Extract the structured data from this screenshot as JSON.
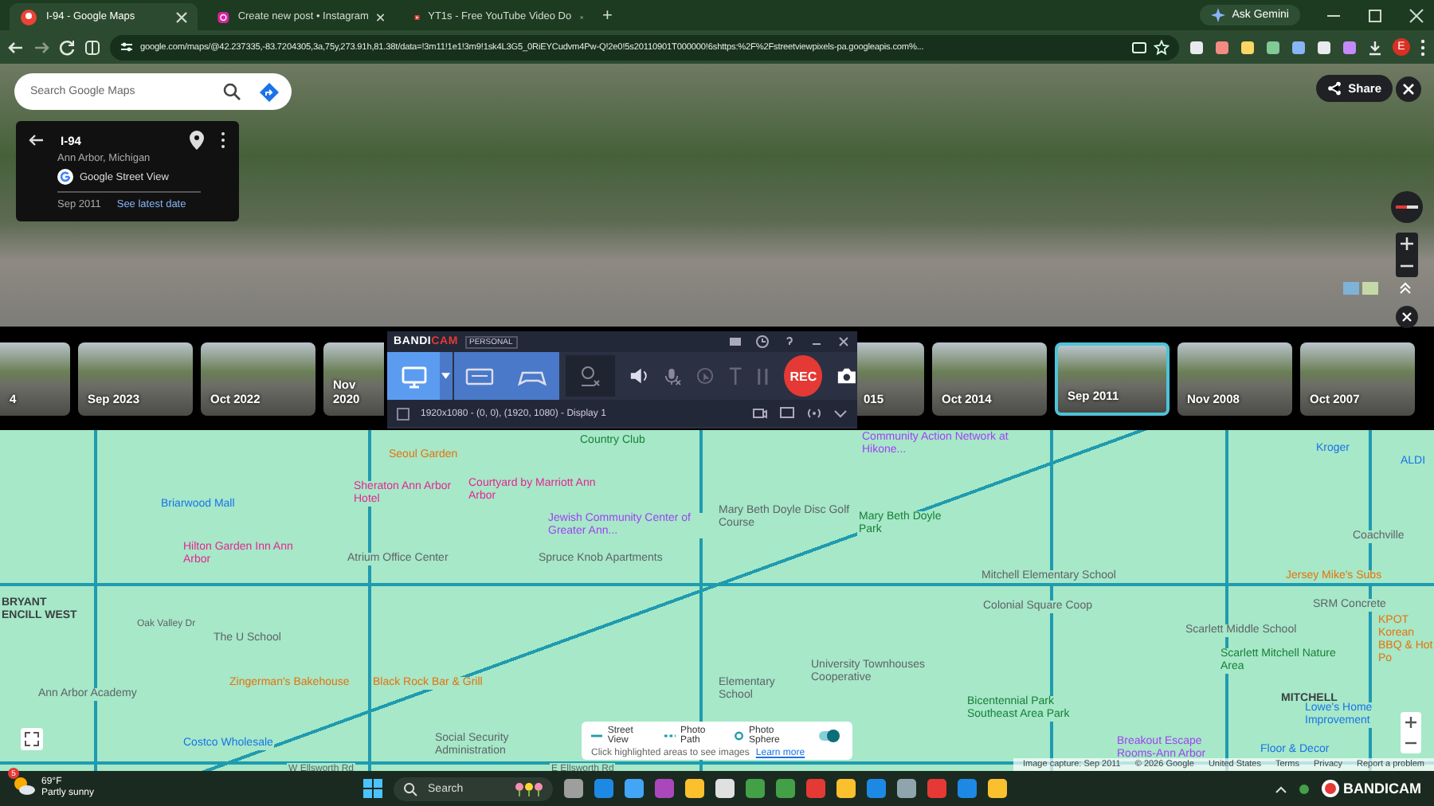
{
  "browser": {
    "tabs": [
      {
        "title": "I-94 - Google Maps",
        "kind": "maps",
        "selected": true
      },
      {
        "title": "Create new post • Instagram",
        "kind": "instagram",
        "selected": false
      },
      {
        "title": "YT1s - Free YouTube Video Do",
        "kind": "video",
        "selected": false
      }
    ],
    "new_tab": "+",
    "gemini": "Ask Gemini",
    "profile": "E",
    "url": "google.com/maps/@42.237335,-83.7204305,3a,75y,273.91h,81.38t/data=!3m11!1e1!3m9!1sk4L3G5_0RiEYCudvm4Pw-Q!2e0!5s20110901T000000!6shttps:%2F%2Fstreetviewpixels-pa.googleapis.com%..."
  },
  "street_view": {
    "search": {
      "placeholder": "Search Google Maps"
    },
    "card": {
      "title": "I-94",
      "subtitle": "Ann Arbor, Michigan",
      "source": "Google Street View",
      "date": "Sep 2011",
      "link": "See latest date"
    },
    "share": "Share"
  },
  "timeline": {
    "before": [
      {
        "label": "4",
        "selected": false
      },
      {
        "label": "Sep 2023",
        "selected": false
      },
      {
        "label": "Oct 2022",
        "selected": false
      },
      {
        "label": "Nov 2020",
        "selected": false
      }
    ],
    "after": [
      {
        "label": "015",
        "selected": false
      },
      {
        "label": "Oct 2014",
        "selected": false
      },
      {
        "label": "Sep 2011",
        "selected": true
      },
      {
        "label": "Nov 2008",
        "selected": false
      },
      {
        "label": "Oct 2007",
        "selected": false
      }
    ]
  },
  "recorder": {
    "logo": [
      "BANDI",
      "CAM"
    ],
    "edition": "PERSONAL",
    "modes": [
      {
        "kind": "screen",
        "selected": true
      },
      {
        "kind": "hdmi",
        "selected": false
      },
      {
        "kind": "game",
        "selected": false
      }
    ],
    "rec": "REC",
    "area": "1920x1080 - (0, 0), (1920, 1080) - Display 1",
    "area_checked": false
  },
  "map": {
    "labels": [
      {
        "text": "Country Club",
        "kind": "park"
      },
      {
        "text": "Community Action Network at Hikone...",
        "kind": "community"
      },
      {
        "text": "Kroger",
        "kind": "shop"
      },
      {
        "text": "Seoul Garden",
        "kind": "food"
      },
      {
        "text": "ALDI",
        "kind": "shop"
      },
      {
        "text": "Sheraton Ann Arbor Hotel",
        "kind": "hotel"
      },
      {
        "text": "Courtyard by Marriott Ann Arbor",
        "kind": "hotel"
      },
      {
        "text": "Briarwood Mall",
        "kind": "shop"
      },
      {
        "text": "Jewish Community Center of Greater Ann...",
        "kind": "community"
      },
      {
        "text": "Mary Beth Doyle Disc Golf Course",
        "kind": "place"
      },
      {
        "text": "Mary Beth Doyle Park",
        "kind": "park"
      },
      {
        "text": "Coachville",
        "kind": "place"
      },
      {
        "text": "Hilton Garden Inn Ann Arbor",
        "kind": "hotel"
      },
      {
        "text": "Atrium Office Center",
        "kind": "place"
      },
      {
        "text": "Spruce Knob Apartments",
        "kind": "place"
      },
      {
        "text": "Mitchell Elementary School",
        "kind": "place"
      },
      {
        "text": "Jersey Mike's Subs",
        "kind": "food"
      },
      {
        "text": "BRYANT",
        "kind": "area"
      },
      {
        "text": "Colonial Square Coop",
        "kind": "place"
      },
      {
        "text": "SRM Concrete",
        "kind": "place"
      },
      {
        "text": "ENCILL WEST",
        "kind": "area"
      },
      {
        "text": "Oak Valley Dr",
        "kind": "road"
      },
      {
        "text": "The U School",
        "kind": "place"
      },
      {
        "text": "Scarlett Middle School",
        "kind": "place"
      },
      {
        "text": "Scarlett Mitchell Nature Area",
        "kind": "park"
      },
      {
        "text": "University Townhouses Cooperative",
        "kind": "place"
      },
      {
        "text": "KPOT Korean BBQ & Hot Po",
        "kind": "food"
      },
      {
        "text": "Ann Arbor Academy",
        "kind": "place"
      },
      {
        "text": "Zingerman's Bakehouse",
        "kind": "food"
      },
      {
        "text": "Black Rock Bar & Grill",
        "kind": "food"
      },
      {
        "text": "Elementary School",
        "kind": "place"
      },
      {
        "text": "Bicentennial Park Southeast Area Park",
        "kind": "park"
      },
      {
        "text": "MITCHELL",
        "kind": "area"
      },
      {
        "text": "Lowe's Home Improvement",
        "kind": "shop"
      },
      {
        "text": "Costco Wholesale",
        "kind": "shop"
      },
      {
        "text": "Social Security Administration",
        "kind": "place"
      },
      {
        "text": "Breakout Escape Rooms-Ann Arbor",
        "kind": "community"
      },
      {
        "text": "Floor & Decor",
        "kind": "shop"
      },
      {
        "text": "W Ellsworth Rd",
        "kind": "road"
      },
      {
        "text": "E Ellsworth Rd",
        "kind": "road"
      }
    ],
    "legend": {
      "street_view": "Street View",
      "photo_path": "Photo Path",
      "photo_sphere": "Photo Sphere",
      "toggle_on": true,
      "hint": "Click highlighted areas to see images",
      "link": "Learn more"
    },
    "footer": [
      "Image capture: Sep 2011",
      "© 2026 Google",
      "United States",
      "Terms",
      "Privacy",
      "Report a problem"
    ]
  },
  "taskbar": {
    "weather": {
      "temp": "69°F",
      "condition": "Partly sunny",
      "badge": "5"
    },
    "search": {
      "placeholder": "Search"
    },
    "tray_logo": "BANDICAM"
  }
}
